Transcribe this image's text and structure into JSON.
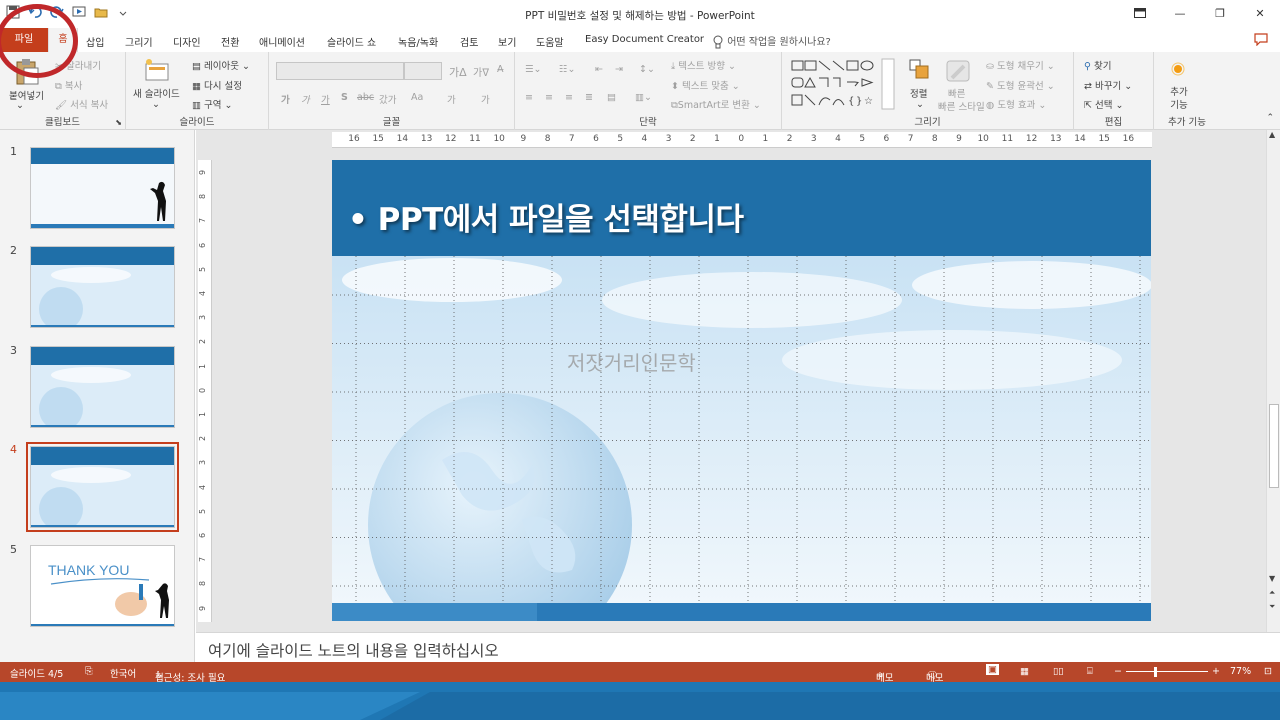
{
  "window": {
    "title": "PPT 비밀번호 설정 및 해제하는 방법  -  PowerPoint",
    "controls": [
      "restore-ribbon",
      "minimize",
      "maximize",
      "close"
    ]
  },
  "tabs": {
    "file": "파일",
    "home": "홈",
    "items": [
      "삽입",
      "그리기",
      "디자인",
      "전환",
      "애니메이션",
      "슬라이드 쇼",
      "녹음/녹화",
      "검토",
      "보기",
      "도움말",
      "Easy Document Creator"
    ],
    "tell_me": "어떤 작업을 원하시나요?"
  },
  "ribbon": {
    "clipboard": {
      "paste": "붙여넣기",
      "cut": "잘라내기",
      "copy": "복사",
      "format_painter": "서식 복사",
      "label": "클립보드"
    },
    "slides": {
      "new_slide": "새 슬라이드",
      "layout": "레이아웃",
      "reset": "다시 설정",
      "section": "구역",
      "label": "슬라이드"
    },
    "font": {
      "bold": "가",
      "italic": "가",
      "underline": "가",
      "strike": "S",
      "spacing": "갔가",
      "case": "Aa",
      "highlight": "가",
      "color": "가",
      "label": "글꼴"
    },
    "paragraph": {
      "text_direction": "텍스트 방향",
      "align_text": "텍스트 맞춤",
      "smartart": "SmartArt로 변환",
      "label": "단락"
    },
    "drawing": {
      "arrange": "정렬",
      "quick_styles": "빠른 스타일",
      "fill": "도형 채우기",
      "outline": "도형 윤곽선",
      "effects": "도형 효과",
      "label": "그리기"
    },
    "editing": {
      "find": "찾기",
      "replace": "바꾸기",
      "select": "선택",
      "label": "편집"
    },
    "addins": {
      "addins": "추가 기능",
      "label": "추가 기능"
    }
  },
  "thumbnails": [
    {
      "num": "1",
      "selected": false,
      "thank_you": ""
    },
    {
      "num": "2",
      "selected": false,
      "thank_you": ""
    },
    {
      "num": "3",
      "selected": false,
      "thank_you": ""
    },
    {
      "num": "4",
      "selected": true,
      "thank_you": ""
    },
    {
      "num": "5",
      "selected": false,
      "thank_you": "THANK YOU"
    }
  ],
  "ruler_h": [
    "16",
    "15",
    "14",
    "13",
    "12",
    "11",
    "10",
    "9",
    "8",
    "7",
    "6",
    "5",
    "4",
    "3",
    "2",
    "1",
    "0",
    "1",
    "2",
    "3",
    "4",
    "5",
    "6",
    "7",
    "8",
    "9",
    "10",
    "11",
    "12",
    "13",
    "14",
    "15",
    "16"
  ],
  "ruler_v": [
    "9",
    "8",
    "7",
    "6",
    "5",
    "4",
    "3",
    "2",
    "1",
    "0",
    "1",
    "2",
    "3",
    "4",
    "5",
    "6",
    "7",
    "8",
    "9"
  ],
  "slide": {
    "bullet": "•",
    "title": "PPT에서 파일을 선택합니다",
    "watermark": "저잣거리인문학"
  },
  "notes_placeholder": "여기에 슬라이드 노트의 내용을 입력하십시오",
  "status": {
    "slide": "슬라이드 4/5",
    "language": "한국어",
    "accessibility": "접근성: 조사 필요",
    "notes": "메모",
    "comments": "메모",
    "zoom": "77%"
  },
  "colors": {
    "accent": "#c43e1c",
    "status": "#b7472a",
    "slide_blue": "#1f6fa8"
  }
}
